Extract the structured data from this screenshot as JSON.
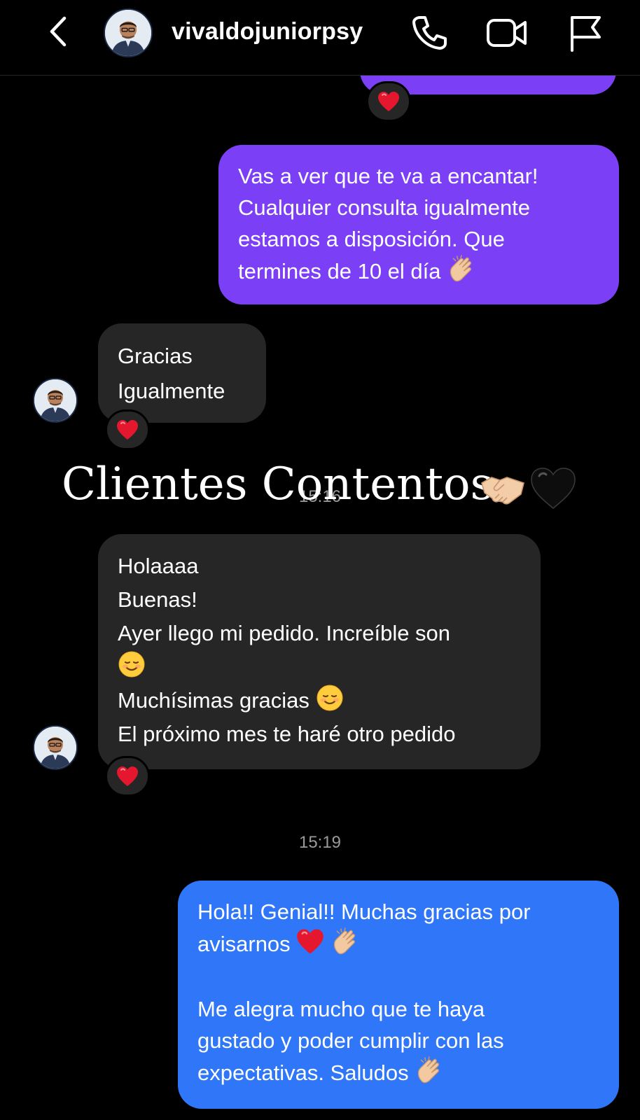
{
  "header": {
    "username": "vivaldojuniorpsy",
    "back_icon": "chevron-left-icon",
    "actions": [
      "phone-icon",
      "video-camera-icon",
      "flag-icon"
    ]
  },
  "messages": {
    "m1": {
      "lines": [
        "Vas a ver que te va a encantar!",
        "Cualquier consulta igualmente",
        "estamos a disposición. Que",
        "termines de 10 el día"
      ]
    },
    "m2": {
      "lines": [
        "Gracias",
        "Igualmente"
      ]
    },
    "timestamp1": "15:16",
    "overlay_caption": "Clientes Contentos",
    "m3": {
      "lines": [
        "Holaaaa",
        "Buenas!",
        "Ayer llego mi pedido. Increíble son",
        "",
        "Muchísimas gracias",
        "El próximo mes te haré otro pedido"
      ]
    },
    "timestamp2": "15:19",
    "m4": {
      "lines": [
        "Hola!! Genial!! Muchas gracias por",
        "avisarnos",
        "Me alegra mucho que te haya",
        "gustado y poder cumplir con las",
        "expectativas. Saludos"
      ]
    }
  },
  "colors": {
    "sent_purple": "#7b3ff5",
    "received_gray": "#262626",
    "sent_blue": "#2f77f8",
    "reaction_heart": "#e5172f"
  }
}
